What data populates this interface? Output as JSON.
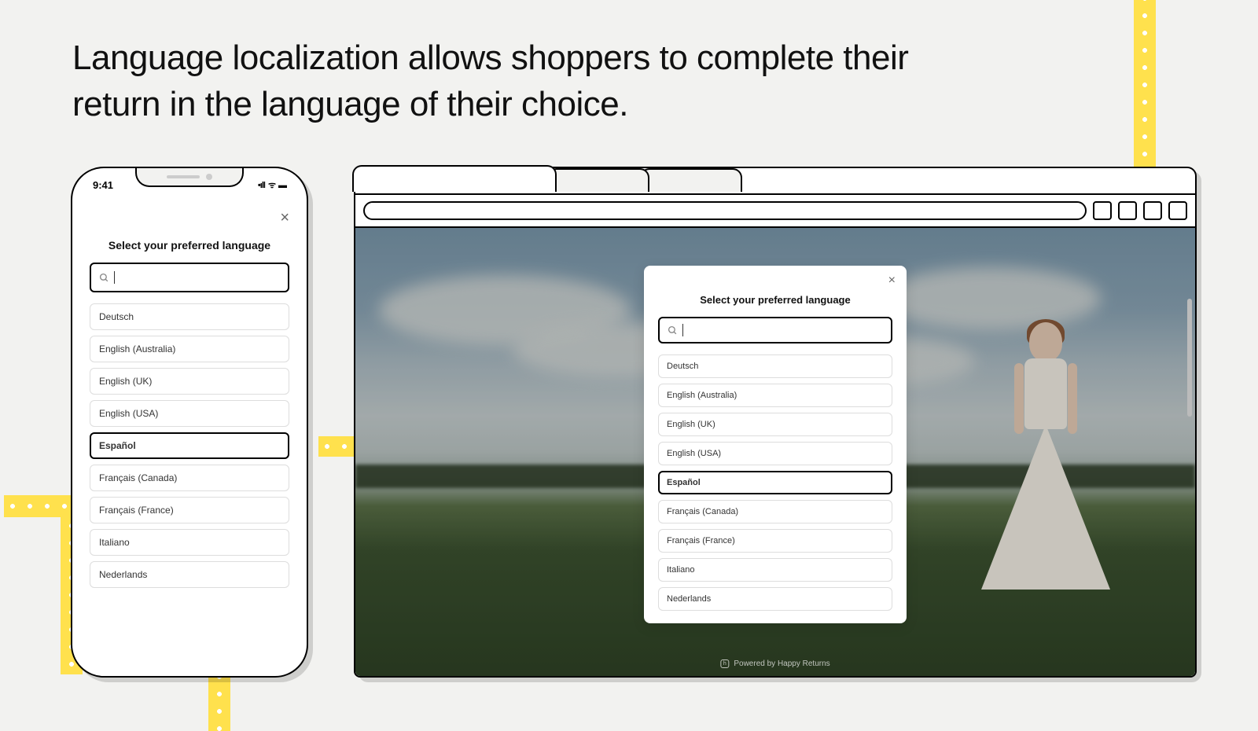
{
  "headline": "Language localization allows shoppers to complete their return in the language of their choice.",
  "phone": {
    "time": "9:41",
    "signal_glyph": "•ıll",
    "wifi_glyph": "ᯤ",
    "battery_glyph": "▬"
  },
  "language_modal": {
    "title": "Select your preferred language",
    "search_placeholder": "",
    "options": [
      {
        "label": "Deutsch",
        "selected": false
      },
      {
        "label": "English (Australia)",
        "selected": false
      },
      {
        "label": "English (UK)",
        "selected": false
      },
      {
        "label": "English (USA)",
        "selected": false
      },
      {
        "label": "Español",
        "selected": true
      },
      {
        "label": "Français (Canada)",
        "selected": false
      },
      {
        "label": "Français (France)",
        "selected": false
      },
      {
        "label": "Italiano",
        "selected": false
      },
      {
        "label": "Nederlands",
        "selected": false
      }
    ]
  },
  "footer": {
    "powered_by_prefix": "Powered by",
    "powered_by_brand": "Happy Returns",
    "powered_by_icon": "h"
  }
}
